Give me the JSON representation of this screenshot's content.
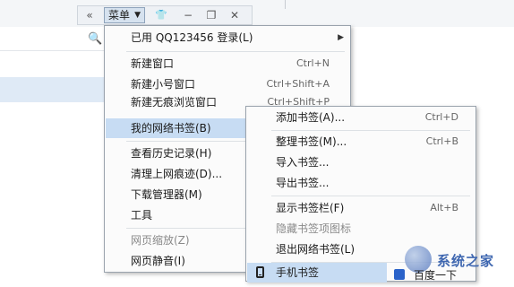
{
  "toolbar": {
    "back_glyph": "«",
    "menu_label": "菜单",
    "caret": "▼",
    "skin_glyph": "👕",
    "minimize_glyph": "−",
    "restore_glyph": "❐",
    "close_glyph": "✕"
  },
  "main_menu": {
    "items": [
      {
        "label": "已用 QQ123456 登录(L)",
        "shortcut": ""
      },
      {
        "label": "新建窗口",
        "shortcut": "Ctrl+N"
      },
      {
        "label": "新建小号窗口",
        "shortcut": "Ctrl+Shift+A"
      },
      {
        "label": "新建无痕浏览窗口",
        "shortcut": "Ctrl+Shift+P"
      },
      {
        "label": "我的网络书签(B)",
        "shortcut": ""
      },
      {
        "label": "查看历史记录(H)",
        "shortcut": ""
      },
      {
        "label": "清理上网痕迹(D)...",
        "shortcut": ""
      },
      {
        "label": "下载管理器(M)",
        "shortcut": ""
      },
      {
        "label": "工具",
        "shortcut": ""
      },
      {
        "label": "网页缩放(Z)",
        "shortcut": ""
      },
      {
        "label": "网页静音(I)",
        "shortcut": ""
      }
    ],
    "submenu_arrow": "▶"
  },
  "bookmarks_submenu": {
    "items": [
      {
        "label": "添加书签(A)...",
        "shortcut": "Ctrl+D"
      },
      {
        "label": "整理书签(M)...",
        "shortcut": "Ctrl+B"
      },
      {
        "label": "导入书签...",
        "shortcut": ""
      },
      {
        "label": "导出书签...",
        "shortcut": ""
      },
      {
        "label": "显示书签栏(F)",
        "shortcut": "Alt+B"
      },
      {
        "label": "隐藏书签项图标",
        "shortcut": ""
      },
      {
        "label": "退出网络书签(L)",
        "shortcut": ""
      },
      {
        "label": "手机书签",
        "shortcut": ""
      }
    ]
  },
  "background": {
    "baidu_link": "百度一下",
    "search_glyph": "🔍",
    "watermark": "系统之家"
  },
  "colors": {
    "highlight": "#c7dcf3",
    "menu_border": "#9aa3ad",
    "disabled_text": "#8a8a8a"
  }
}
